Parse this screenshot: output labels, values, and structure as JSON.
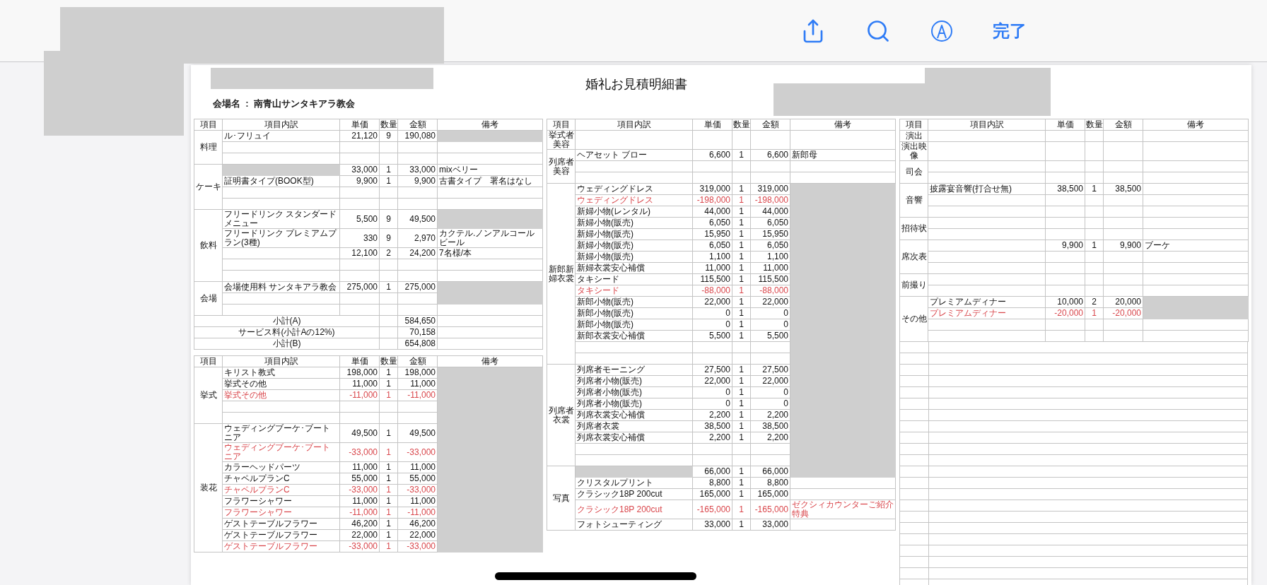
{
  "toolbar": {
    "done_label": "完了"
  },
  "document": {
    "title": "婚礼お見積明細書",
    "venue_line": "会場名  :  南青山サンタキアラ教会",
    "panels": [
      {
        "tables": [
          {
            "columns": [
              "項目",
              "項目内訳",
              "単価",
              "数量",
              "金額",
              "備考"
            ],
            "groups": [
              {
                "category": "料理",
                "rows": [
                  {
                    "kind": "item",
                    "item": "ル･フリュイ",
                    "price": "21,120",
                    "qty": "9",
                    "amount": "190,080",
                    "discount": false,
                    "item_redacted": false,
                    "note_redacted": true
                  },
                  {
                    "kind": "empty",
                    "note_redacted": false
                  },
                  {
                    "kind": "empty",
                    "note_redacted": false
                  }
                ]
              },
              {
                "category": "ケーキ",
                "rows": [
                  {
                    "kind": "item",
                    "price": "33,000",
                    "qty": "1",
                    "amount": "33,000",
                    "note": "mixベリー",
                    "discount": false,
                    "item_redacted": true,
                    "note_redacted": false
                  },
                  {
                    "kind": "item",
                    "item": "証明書タイプ(BOOK型)",
                    "price": "9,900",
                    "qty": "1",
                    "amount": "9,900",
                    "note": "古書タイプ　署名はなし",
                    "discount": false,
                    "item_redacted": false,
                    "note_redacted": false
                  },
                  {
                    "kind": "empty",
                    "note_redacted": false
                  },
                  {
                    "kind": "empty",
                    "note_redacted": false
                  }
                ]
              },
              {
                "category": "飲料",
                "rows": [
                  {
                    "kind": "item",
                    "item": "フリードリンク スタンダードメニュー",
                    "price": "5,500",
                    "qty": "9",
                    "amount": "49,500",
                    "discount": false,
                    "item_redacted": false,
                    "note_redacted": true
                  },
                  {
                    "kind": "item",
                    "item": "フリードリンク プレミアムプラン(3種)",
                    "price": "330",
                    "qty": "9",
                    "amount": "2,970",
                    "note": "カクテル.ノンアルコールビール",
                    "discount": false,
                    "item_redacted": false,
                    "note_redacted": false
                  },
                  {
                    "kind": "item",
                    "price": "12,100",
                    "qty": "2",
                    "amount": "24,200",
                    "note": "7名様/本",
                    "discount": false,
                    "item_redacted": false,
                    "note_redacted": false
                  },
                  {
                    "kind": "empty",
                    "note_redacted": false
                  },
                  {
                    "kind": "empty",
                    "note_redacted": false
                  }
                ]
              },
              {
                "category": "会場",
                "rows": [
                  {
                    "kind": "item",
                    "item": "会場使用料 サンタキアラ教会",
                    "price": "275,000",
                    "qty": "1",
                    "amount": "275,000",
                    "discount": false,
                    "item_redacted": false,
                    "note_redacted": true
                  },
                  {
                    "kind": "empty",
                    "note_redacted": true
                  },
                  {
                    "kind": "empty",
                    "note_redacted": false
                  }
                ]
              }
            ],
            "subtotals": [
              {
                "label": "小計(A)",
                "amount": "584,650"
              },
              {
                "label": "サービス料(小計Aの12%)",
                "amount": "70,158"
              },
              {
                "label": "小計(B)",
                "amount": "654,808"
              }
            ]
          },
          {
            "columns": [
              "項目",
              "項目内訳",
              "単価",
              "数量",
              "金額",
              "備考"
            ],
            "groups": [
              {
                "category": "挙式",
                "rows": [
                  {
                    "kind": "item",
                    "item": "キリスト教式",
                    "price": "198,000",
                    "qty": "1",
                    "amount": "198,000",
                    "discount": false,
                    "item_redacted": false,
                    "note_redacted": true
                  },
                  {
                    "kind": "item",
                    "item": "挙式その他",
                    "price": "11,000",
                    "qty": "1",
                    "amount": "11,000",
                    "discount": false,
                    "item_redacted": false,
                    "note_redacted": true
                  },
                  {
                    "kind": "item",
                    "item": "挙式その他",
                    "price": "-11,000",
                    "qty": "1",
                    "amount": "-11,000",
                    "discount": true,
                    "item_redacted": false,
                    "note_redacted": true
                  },
                  {
                    "kind": "empty",
                    "note_redacted": true
                  },
                  {
                    "kind": "empty",
                    "note_redacted": true
                  }
                ]
              },
              {
                "category": "装花",
                "rows": [
                  {
                    "kind": "item",
                    "item": "ウェディングブーケ･ブートニア",
                    "price": "49,500",
                    "qty": "1",
                    "amount": "49,500",
                    "discount": false,
                    "item_redacted": false,
                    "note_redacted": true
                  },
                  {
                    "kind": "item",
                    "item": "ウェディングブーケ･ブートニア",
                    "price": "-33,000",
                    "qty": "1",
                    "amount": "-33,000",
                    "discount": true,
                    "item_redacted": false,
                    "note_redacted": true
                  },
                  {
                    "kind": "item",
                    "item": "カラーヘッドパーツ",
                    "price": "11,000",
                    "qty": "1",
                    "amount": "11,000",
                    "discount": false,
                    "item_redacted": false,
                    "note_redacted": true
                  },
                  {
                    "kind": "item",
                    "item": "チャペルプランC",
                    "price": "55,000",
                    "qty": "1",
                    "amount": "55,000",
                    "discount": false,
                    "item_redacted": false,
                    "note_redacted": true
                  },
                  {
                    "kind": "item",
                    "item": "チャペルプランC",
                    "price": "-33,000",
                    "qty": "1",
                    "amount": "-33,000",
                    "discount": true,
                    "item_redacted": false,
                    "note_redacted": true
                  },
                  {
                    "kind": "item",
                    "item": "フラワーシャワー",
                    "price": "11,000",
                    "qty": "1",
                    "amount": "11,000",
                    "discount": false,
                    "item_redacted": false,
                    "note_redacted": true
                  },
                  {
                    "kind": "item",
                    "item": "フラワーシャワー",
                    "price": "-11,000",
                    "qty": "1",
                    "amount": "-11,000",
                    "discount": true,
                    "item_redacted": false,
                    "note_redacted": true
                  },
                  {
                    "kind": "item",
                    "item": "ゲストテーブルフラワー",
                    "price": "46,200",
                    "qty": "1",
                    "amount": "46,200",
                    "discount": false,
                    "item_redacted": false,
                    "note_redacted": true
                  },
                  {
                    "kind": "item",
                    "item": "ゲストテーブルフラワー",
                    "price": "22,000",
                    "qty": "1",
                    "amount": "22,000",
                    "discount": false,
                    "item_redacted": false,
                    "note_redacted": true
                  },
                  {
                    "kind": "item",
                    "item": "ゲストテーブルフラワー",
                    "price": "-33,000",
                    "qty": "1",
                    "amount": "-33,000",
                    "discount": true,
                    "item_redacted": false,
                    "note_redacted": true
                  }
                ]
              }
            ]
          }
        ]
      },
      {
        "tables": [
          {
            "columns": [
              "項目",
              "項目内訳",
              "単価",
              "数量",
              "金額",
              "備考"
            ],
            "groups": [
              {
                "category": "挙式者美容",
                "rows": [
                  {
                    "kind": "empty",
                    "note_redacted": false
                  }
                ]
              },
              {
                "category": "列席者美容",
                "rows": [
                  {
                    "kind": "item",
                    "item": "ヘアセット ブロー",
                    "price": "6,600",
                    "qty": "1",
                    "amount": "6,600",
                    "note": "新郎母",
                    "discount": false,
                    "item_redacted": false,
                    "note_redacted": false
                  },
                  {
                    "kind": "empty",
                    "note_redacted": false
                  },
                  {
                    "kind": "empty",
                    "note_redacted": false
                  }
                ]
              },
              {
                "category": "新郎新婦衣裳",
                "rows": [
                  {
                    "kind": "item",
                    "item": "ウェディングドレス",
                    "price": "319,000",
                    "qty": "1",
                    "amount": "319,000",
                    "discount": false,
                    "item_redacted": false,
                    "note_redacted": true
                  },
                  {
                    "kind": "item",
                    "item": "ウェディングドレス",
                    "price": "-198,000",
                    "qty": "1",
                    "amount": "-198,000",
                    "discount": true,
                    "item_redacted": false,
                    "note_redacted": true
                  },
                  {
                    "kind": "item",
                    "item": "新婦小物(レンタル)",
                    "price": "44,000",
                    "qty": "1",
                    "amount": "44,000",
                    "discount": false,
                    "item_redacted": false,
                    "note_redacted": true
                  },
                  {
                    "kind": "item",
                    "item": "新婦小物(販売)",
                    "price": "6,050",
                    "qty": "1",
                    "amount": "6,050",
                    "discount": false,
                    "item_redacted": false,
                    "note_redacted": true
                  },
                  {
                    "kind": "item",
                    "item": "新婦小物(販売)",
                    "price": "15,950",
                    "qty": "1",
                    "amount": "15,950",
                    "discount": false,
                    "item_redacted": false,
                    "note_redacted": true
                  },
                  {
                    "kind": "item",
                    "item": "新婦小物(販売)",
                    "price": "6,050",
                    "qty": "1",
                    "amount": "6,050",
                    "discount": false,
                    "item_redacted": false,
                    "note_redacted": true
                  },
                  {
                    "kind": "item",
                    "item": "新婦小物(販売)",
                    "price": "1,100",
                    "qty": "1",
                    "amount": "1,100",
                    "discount": false,
                    "item_redacted": false,
                    "note_redacted": true
                  },
                  {
                    "kind": "item",
                    "item": "新婦衣裳安心補償",
                    "price": "11,000",
                    "qty": "1",
                    "amount": "11,000",
                    "discount": false,
                    "item_redacted": false,
                    "note_redacted": true
                  },
                  {
                    "kind": "item",
                    "item": "タキシード",
                    "price": "115,500",
                    "qty": "1",
                    "amount": "115,500",
                    "discount": false,
                    "item_redacted": false,
                    "note_redacted": true
                  },
                  {
                    "kind": "item",
                    "item": "タキシード",
                    "price": "-88,000",
                    "qty": "1",
                    "amount": "-88,000",
                    "discount": true,
                    "item_redacted": false,
                    "note_redacted": true
                  },
                  {
                    "kind": "item",
                    "item": "新郎小物(販売)",
                    "price": "22,000",
                    "qty": "1",
                    "amount": "22,000",
                    "discount": false,
                    "item_redacted": false,
                    "note_redacted": true
                  },
                  {
                    "kind": "item",
                    "item": "新郎小物(販売)",
                    "price": "0",
                    "qty": "1",
                    "amount": "0",
                    "discount": false,
                    "item_redacted": false,
                    "note_redacted": true
                  },
                  {
                    "kind": "item",
                    "item": "新郎小物(販売)",
                    "price": "0",
                    "qty": "1",
                    "amount": "0",
                    "discount": false,
                    "item_redacted": false,
                    "note_redacted": true
                  },
                  {
                    "kind": "item",
                    "item": "新郎衣裳安心補償",
                    "price": "5,500",
                    "qty": "1",
                    "amount": "5,500",
                    "discount": false,
                    "item_redacted": false,
                    "note_redacted": true
                  },
                  {
                    "kind": "empty",
                    "note_redacted": true
                  },
                  {
                    "kind": "empty",
                    "note_redacted": true
                  }
                ]
              },
              {
                "category": "列席者衣裳",
                "rows": [
                  {
                    "kind": "item",
                    "item": "列席者モーニング",
                    "price": "27,500",
                    "qty": "1",
                    "amount": "27,500",
                    "discount": false,
                    "item_redacted": false,
                    "note_redacted": true
                  },
                  {
                    "kind": "item",
                    "item": "列席者小物(販売)",
                    "price": "22,000",
                    "qty": "1",
                    "amount": "22,000",
                    "discount": false,
                    "item_redacted": false,
                    "note_redacted": true
                  },
                  {
                    "kind": "item",
                    "item": "列席者小物(販売)",
                    "price": "0",
                    "qty": "1",
                    "amount": "0",
                    "discount": false,
                    "item_redacted": false,
                    "note_redacted": true
                  },
                  {
                    "kind": "item",
                    "item": "列席者小物(販売)",
                    "price": "0",
                    "qty": "1",
                    "amount": "0",
                    "discount": false,
                    "item_redacted": false,
                    "note_redacted": true
                  },
                  {
                    "kind": "item",
                    "item": "列席衣裳安心補償",
                    "price": "2,200",
                    "qty": "1",
                    "amount": "2,200",
                    "discount": false,
                    "item_redacted": false,
                    "note_redacted": true
                  },
                  {
                    "kind": "item",
                    "item": "列席者衣裳",
                    "price": "38,500",
                    "qty": "1",
                    "amount": "38,500",
                    "discount": false,
                    "item_redacted": false,
                    "note_redacted": true
                  },
                  {
                    "kind": "item",
                    "item": "列席衣裳安心補償",
                    "price": "2,200",
                    "qty": "1",
                    "amount": "2,200",
                    "discount": false,
                    "item_redacted": false,
                    "note_redacted": true
                  },
                  {
                    "kind": "empty",
                    "note_redacted": true
                  },
                  {
                    "kind": "empty",
                    "note_redacted": true
                  }
                ]
              },
              {
                "category": "写真",
                "rows": [
                  {
                    "kind": "item",
                    "price": "66,000",
                    "qty": "1",
                    "amount": "66,000",
                    "discount": false,
                    "item_redacted": true,
                    "note_redacted": true
                  },
                  {
                    "kind": "item",
                    "item": "クリスタルプリント",
                    "price": "8,800",
                    "qty": "1",
                    "amount": "8,800",
                    "discount": false,
                    "item_redacted": false,
                    "note_redacted": false
                  },
                  {
                    "kind": "item",
                    "item": "クラシック18P 200cut",
                    "price": "165,000",
                    "qty": "1",
                    "amount": "165,000",
                    "discount": false,
                    "item_redacted": false,
                    "note_redacted": false
                  },
                  {
                    "kind": "item",
                    "item": "クラシック18P 200cut",
                    "price": "-165,000",
                    "qty": "1",
                    "amount": "-165,000",
                    "note": "ゼクシィカウンターご紹介特典",
                    "discount": true,
                    "item_redacted": false,
                    "note_redacted": false
                  },
                  {
                    "kind": "item",
                    "item": "フォトシューティング",
                    "price": "33,000",
                    "qty": "1",
                    "amount": "33,000",
                    "discount": false,
                    "item_redacted": false,
                    "note_redacted": false
                  }
                ]
              }
            ]
          }
        ]
      },
      {
        "tables": [
          {
            "columns": [
              "項目",
              "項目内訳",
              "単価",
              "数量",
              "金額",
              "備考"
            ],
            "groups": [
              {
                "category": "演出",
                "rows": [
                  {
                    "kind": "empty",
                    "note_redacted": false
                  }
                ]
              },
              {
                "category": "演出映像",
                "rows": [
                  {
                    "kind": "empty",
                    "note_redacted": false
                  }
                ]
              },
              {
                "category": "司会",
                "rows": [
                  {
                    "kind": "empty",
                    "note_redacted": false
                  },
                  {
                    "kind": "empty",
                    "note_redacted": false
                  }
                ]
              },
              {
                "category": "音響",
                "rows": [
                  {
                    "kind": "item",
                    "item": "披露宴音響(打合せ無)",
                    "price": "38,500",
                    "qty": "1",
                    "amount": "38,500",
                    "discount": false,
                    "item_redacted": false,
                    "note_redacted": false
                  },
                  {
                    "kind": "empty",
                    "note_redacted": false
                  },
                  {
                    "kind": "empty",
                    "note_redacted": false
                  }
                ]
              },
              {
                "category": "招待状",
                "rows": [
                  {
                    "kind": "empty",
                    "note_redacted": false
                  },
                  {
                    "kind": "empty",
                    "note_redacted": false
                  }
                ]
              },
              {
                "category": "席次表",
                "rows": [
                  {
                    "kind": "item",
                    "price": "9,900",
                    "qty": "1",
                    "amount": "9,900",
                    "note": "ブーケ",
                    "discount": false,
                    "item_redacted": false,
                    "note_redacted": false
                  },
                  {
                    "kind": "empty",
                    "note_redacted": false
                  },
                  {
                    "kind": "empty",
                    "note_redacted": false
                  }
                ]
              },
              {
                "category": "前撮り",
                "rows": [
                  {
                    "kind": "empty",
                    "note_redacted": false
                  },
                  {
                    "kind": "empty",
                    "note_redacted": false
                  }
                ]
              },
              {
                "category": "その他",
                "rows": [
                  {
                    "kind": "item",
                    "item": "プレミアムディナー",
                    "price": "10,000",
                    "qty": "2",
                    "amount": "20,000",
                    "discount": false,
                    "item_redacted": false,
                    "note_redacted": true
                  },
                  {
                    "kind": "item",
                    "item": "プレミアムディナー",
                    "price": "-20,000",
                    "qty": "1",
                    "amount": "-20,000",
                    "discount": true,
                    "item_redacted": false,
                    "note_redacted": true
                  },
                  {
                    "kind": "empty",
                    "note_redacted": false
                  },
                  {
                    "kind": "empty",
                    "note_redacted": false
                  }
                ]
              }
            ]
          }
        ]
      }
    ]
  }
}
